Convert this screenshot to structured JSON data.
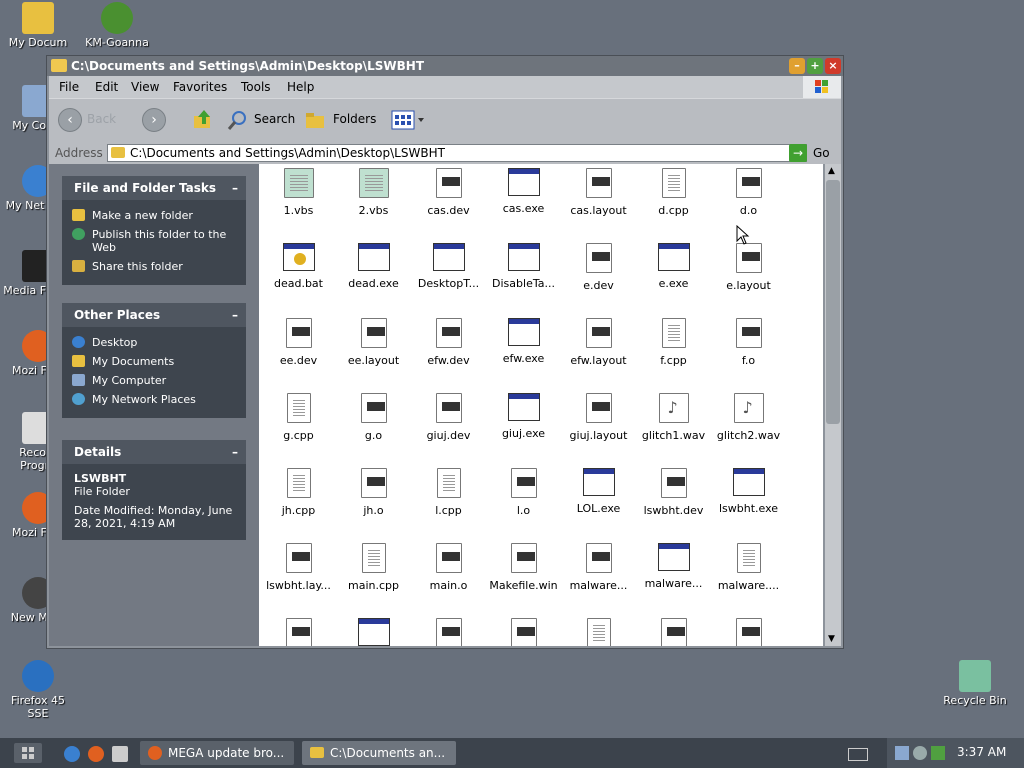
{
  "desktop": {
    "icons": [
      {
        "label": "My Documents",
        "short": "My Docum",
        "name": "my-documents"
      },
      {
        "label": "KM-Goanna",
        "short": "KM-Goanna",
        "name": "km-goanna"
      },
      {
        "label": "My Computer",
        "short": "My Comp",
        "name": "my-computer"
      },
      {
        "label": "My Network Places",
        "short": "My Net Plac",
        "name": "my-network-places"
      },
      {
        "label": "Media Player Classic",
        "short": "Media F Clas",
        "name": "media-player-classic"
      },
      {
        "label": "Mozilla Firefox",
        "short": "Mozi Firef",
        "name": "mozilla-firefox-1"
      },
      {
        "label": "Recommended Programs",
        "short": "Recom Progra",
        "name": "recommended-programs"
      },
      {
        "label": "Mozilla Firefox",
        "short": "Mozi Firef",
        "name": "mozilla-firefox-2"
      },
      {
        "label": "New Moon SSE",
        "short": "New M SS",
        "name": "new-moon-sse"
      },
      {
        "label": "Firefox 45 SSE",
        "short": "Firefox 45 SSE",
        "name": "firefox-45-sse"
      },
      {
        "label": "Recycle Bin",
        "short": "Recycle Bin",
        "name": "recycle-bin"
      }
    ]
  },
  "window": {
    "title": "C:\\Documents and Settings\\Admin\\Desktop\\LSWBHT",
    "menu": [
      "File",
      "Edit",
      "View",
      "Favorites",
      "Tools",
      "Help"
    ],
    "toolbar": {
      "back": "Back",
      "search": "Search",
      "folders": "Folders"
    },
    "address": {
      "label": "Address",
      "value": "C:\\Documents and Settings\\Admin\\Desktop\\LSWBHT",
      "go": "Go"
    }
  },
  "left_pane": {
    "file_tasks": {
      "title": "File and Folder Tasks",
      "items": [
        "Make a new folder",
        "Publish this folder to the Web",
        "Share this folder"
      ]
    },
    "other_places": {
      "title": "Other Places",
      "items": [
        "Desktop",
        "My Documents",
        "My Computer",
        "My Network Places"
      ]
    },
    "details": {
      "title": "Details",
      "name": "LSWBHT",
      "type": "File Folder",
      "modified": "Date Modified: Monday, June 28, 2021, 4:19 AM"
    }
  },
  "files": [
    {
      "name": "1.vbs",
      "kind": "script"
    },
    {
      "name": "2.vbs",
      "kind": "script"
    },
    {
      "name": "cas.dev",
      "kind": "dev"
    },
    {
      "name": "cas.exe",
      "kind": "exe"
    },
    {
      "name": "cas.layout",
      "kind": "dev"
    },
    {
      "name": "d.cpp",
      "kind": "text"
    },
    {
      "name": "d.o",
      "kind": "dev"
    },
    {
      "name": "dead.bat",
      "kind": "bat"
    },
    {
      "name": "dead.exe",
      "kind": "exe"
    },
    {
      "name": "DesktopT...",
      "kind": "exe"
    },
    {
      "name": "DisableTa...",
      "kind": "exe"
    },
    {
      "name": "e.dev",
      "kind": "dev"
    },
    {
      "name": "e.exe",
      "kind": "exe"
    },
    {
      "name": "e.layout",
      "kind": "dev"
    },
    {
      "name": "ee.dev",
      "kind": "dev"
    },
    {
      "name": "ee.layout",
      "kind": "dev"
    },
    {
      "name": "efw.dev",
      "kind": "dev"
    },
    {
      "name": "efw.exe",
      "kind": "exe"
    },
    {
      "name": "efw.layout",
      "kind": "dev"
    },
    {
      "name": "f.cpp",
      "kind": "text"
    },
    {
      "name": "f.o",
      "kind": "dev"
    },
    {
      "name": "g.cpp",
      "kind": "text"
    },
    {
      "name": "g.o",
      "kind": "dev"
    },
    {
      "name": "giuj.dev",
      "kind": "dev"
    },
    {
      "name": "giuj.exe",
      "kind": "exe"
    },
    {
      "name": "giuj.layout",
      "kind": "dev"
    },
    {
      "name": "glitch1.wav",
      "kind": "wav"
    },
    {
      "name": "glitch2.wav",
      "kind": "wav"
    },
    {
      "name": "jh.cpp",
      "kind": "text"
    },
    {
      "name": "jh.o",
      "kind": "dev"
    },
    {
      "name": "l.cpp",
      "kind": "text"
    },
    {
      "name": "l.o",
      "kind": "dev"
    },
    {
      "name": "LOL.exe",
      "kind": "exe"
    },
    {
      "name": "lswbht.dev",
      "kind": "dev"
    },
    {
      "name": "lswbht.exe",
      "kind": "exe"
    },
    {
      "name": "lswbht.lay...",
      "kind": "dev"
    },
    {
      "name": "main.cpp",
      "kind": "text"
    },
    {
      "name": "main.o",
      "kind": "dev"
    },
    {
      "name": "Makefile.win",
      "kind": "dev"
    },
    {
      "name": "malware...",
      "kind": "dev"
    },
    {
      "name": "malware...",
      "kind": "exe"
    },
    {
      "name": "malware....",
      "kind": "text"
    },
    {
      "name": "",
      "kind": "dev"
    },
    {
      "name": "",
      "kind": "exe"
    },
    {
      "name": "",
      "kind": "dev"
    },
    {
      "name": "",
      "kind": "dev"
    },
    {
      "name": "",
      "kind": "text"
    },
    {
      "name": "",
      "kind": "dev"
    },
    {
      "name": "",
      "kind": "dev"
    }
  ],
  "taskbar": {
    "items": [
      "MEGA update bro...",
      "C:\\Documents an..."
    ],
    "clock": "3:37 AM"
  }
}
